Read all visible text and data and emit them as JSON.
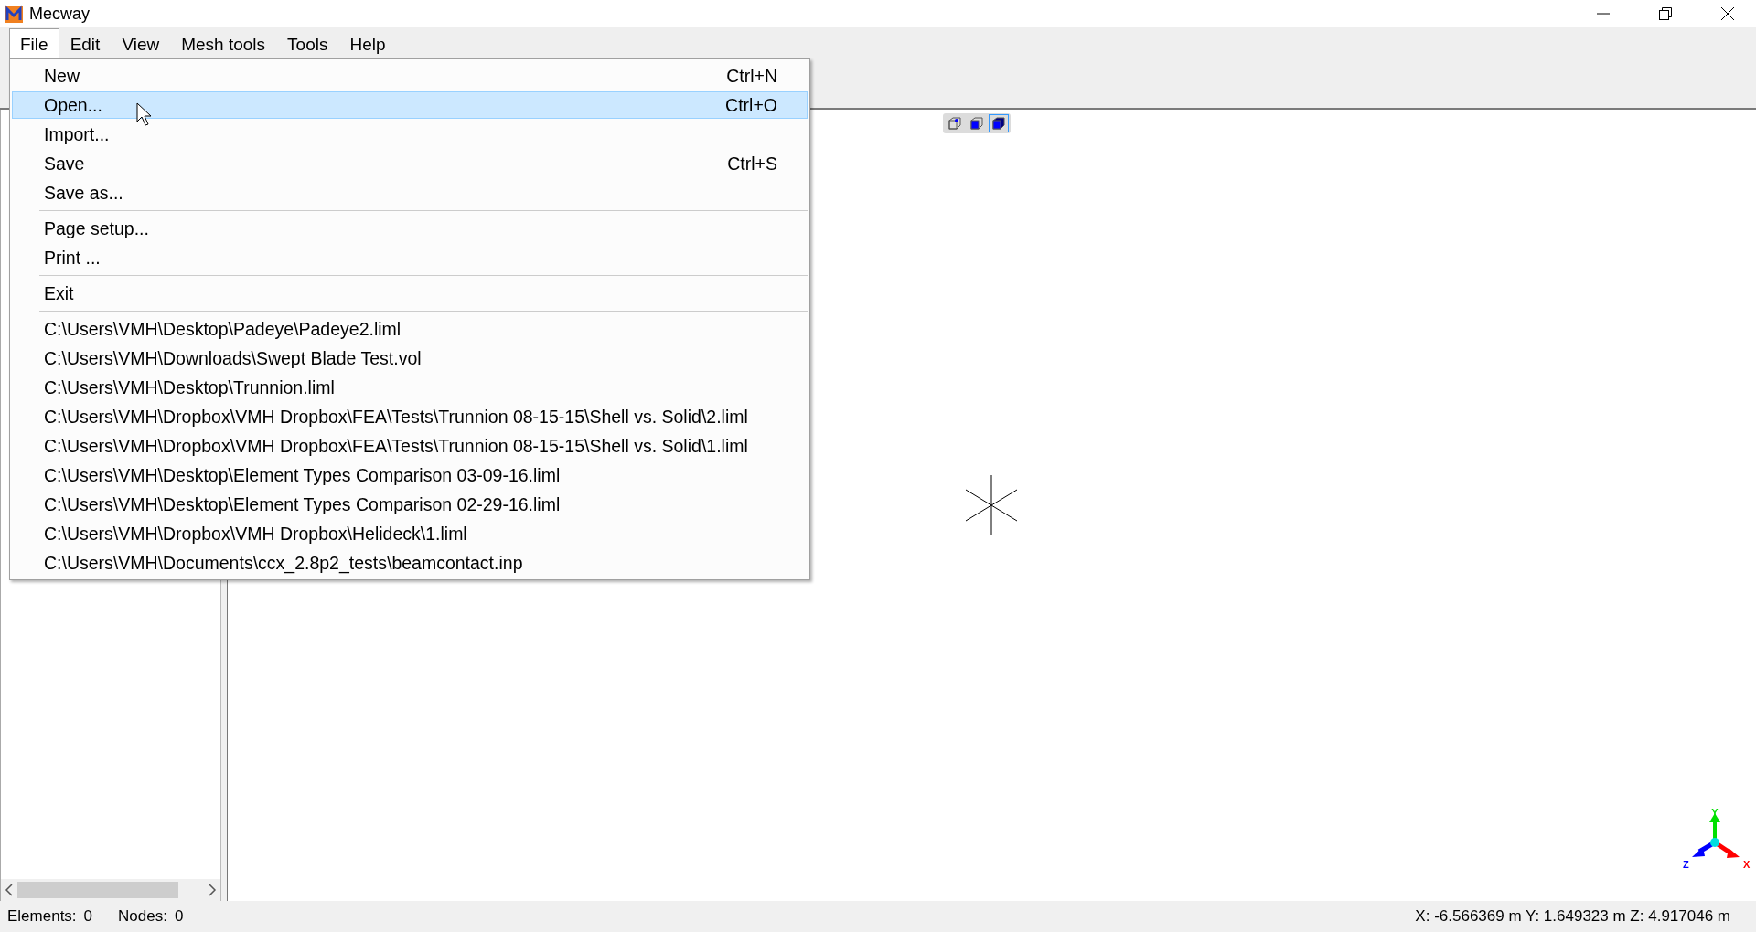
{
  "window": {
    "title": "Mecway"
  },
  "menubar": [
    {
      "label": "File",
      "selected": true
    },
    {
      "label": "Edit",
      "selected": false
    },
    {
      "label": "View",
      "selected": false
    },
    {
      "label": "Mesh tools",
      "selected": false
    },
    {
      "label": "Tools",
      "selected": false
    },
    {
      "label": "Help",
      "selected": false
    }
  ],
  "file_menu": [
    {
      "kind": "item",
      "label": "New",
      "shortcut": "Ctrl+N",
      "selected": false
    },
    {
      "kind": "item",
      "label": "Open...",
      "shortcut": "Ctrl+O",
      "selected": true
    },
    {
      "kind": "item",
      "label": "Import...",
      "selected": false
    },
    {
      "kind": "item",
      "label": "Save",
      "shortcut": "Ctrl+S",
      "selected": false
    },
    {
      "kind": "item",
      "label": "Save as...",
      "selected": false
    },
    {
      "kind": "separator"
    },
    {
      "kind": "item",
      "label": "Page setup...",
      "selected": false
    },
    {
      "kind": "item",
      "label": "Print ...",
      "selected": false
    },
    {
      "kind": "separator"
    },
    {
      "kind": "item",
      "label": "Exit",
      "selected": false
    },
    {
      "kind": "separator"
    },
    {
      "kind": "item",
      "label": "C:\\Users\\VMH\\Desktop\\Padeye\\Padeye2.liml",
      "selected": false
    },
    {
      "kind": "item",
      "label": "C:\\Users\\VMH\\Downloads\\Swept Blade Test.vol",
      "selected": false
    },
    {
      "kind": "item",
      "label": "C:\\Users\\VMH\\Desktop\\Trunnion.liml",
      "selected": false
    },
    {
      "kind": "item",
      "label": "C:\\Users\\VMH\\Dropbox\\VMH Dropbox\\FEA\\Tests\\Trunnion 08-15-15\\Shell vs. Solid\\2.liml",
      "selected": false
    },
    {
      "kind": "item",
      "label": "C:\\Users\\VMH\\Dropbox\\VMH Dropbox\\FEA\\Tests\\Trunnion 08-15-15\\Shell vs. Solid\\1.liml",
      "selected": false
    },
    {
      "kind": "item",
      "label": "C:\\Users\\VMH\\Desktop\\Element Types Comparison 03-09-16.liml",
      "selected": false
    },
    {
      "kind": "item",
      "label": "C:\\Users\\VMH\\Desktop\\Element Types Comparison 02-29-16.liml",
      "selected": false
    },
    {
      "kind": "item",
      "label": "C:\\Users\\VMH\\Dropbox\\VMH Dropbox\\Helideck\\1.liml",
      "selected": false
    },
    {
      "kind": "item",
      "label": "C:\\Users\\VMH\\Documents\\ccx_2.8p2_tests\\beamcontact.inp",
      "selected": false
    }
  ],
  "view_buttons": [
    {
      "kind": "wireframe",
      "selected": false
    },
    {
      "kind": "solid",
      "selected": false
    },
    {
      "kind": "shaded",
      "selected": true
    }
  ],
  "axes": {
    "x": "X",
    "y": "Y",
    "z": "Z"
  },
  "status_bar": {
    "elements_label": "Elements:",
    "elements": "0",
    "nodes_label": "Nodes:",
    "nodes": "0",
    "coordinates": "X: -6.566369 m Y: 1.649323 m Z: 4.917046 m"
  }
}
